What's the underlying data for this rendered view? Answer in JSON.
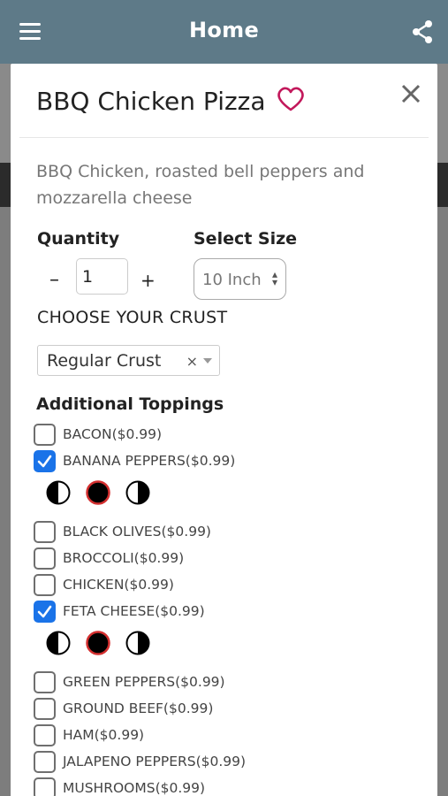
{
  "appbar": {
    "title": "Home",
    "menu_icon": "menu-icon",
    "share_icon": "share-icon"
  },
  "product": {
    "name": "BBQ Chicken Pizza",
    "description": "BBQ Chicken, roasted bell peppers and mozzarella cheese",
    "favorite_icon": "heart-outline-icon",
    "close_icon": "close-icon"
  },
  "quantity": {
    "label": "Quantity",
    "minus": "–",
    "plus": "+",
    "value": "1"
  },
  "size": {
    "label": "Select Size",
    "selected": "10 Inch"
  },
  "crust": {
    "label": "CHOOSE YOUR CRUST",
    "selected": "Regular Crust",
    "clear": "×"
  },
  "toppings": {
    "label": "Additional Toppings",
    "items": [
      {
        "label": "BACON($0.99)",
        "checked": false
      },
      {
        "label": "BANANA PEPPERS($0.99)",
        "checked": true
      },
      {
        "label": "BLACK OLIVES($0.99)",
        "checked": false
      },
      {
        "label": "BROCCOLI($0.99)",
        "checked": false
      },
      {
        "label": "CHICKEN($0.99)",
        "checked": false
      },
      {
        "label": "FETA CHEESE($0.99)",
        "checked": true
      },
      {
        "label": "GREEN PEPPERS($0.99)",
        "checked": false
      },
      {
        "label": "GROUND BEEF($0.99)",
        "checked": false
      },
      {
        "label": "HAM($0.99)",
        "checked": false
      },
      {
        "label": "JALAPENO PEPPERS($0.99)",
        "checked": false
      },
      {
        "label": "MUSHROOMS($0.99)",
        "checked": false
      }
    ],
    "placement_icons": [
      "left-half-icon",
      "whole-pizza-icon",
      "right-half-icon"
    ]
  },
  "colors": {
    "appbar": "#5e7a88",
    "accent": "#1a73e8",
    "heart": "#c2185b",
    "selected_ring": "#d32f2f"
  }
}
